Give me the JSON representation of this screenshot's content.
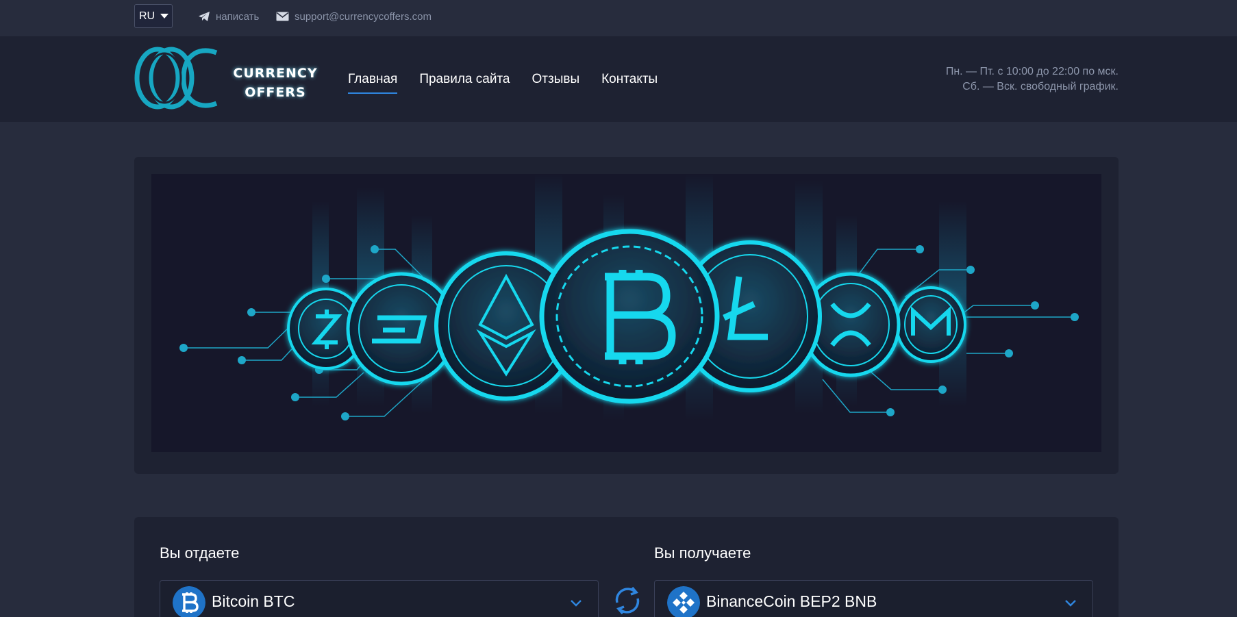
{
  "topbar": {
    "language": "RU",
    "write_label": "написать",
    "email": "support@currencycoffers.com"
  },
  "header": {
    "logo_line1": "CURRENCY",
    "logo_line2": "OFFERS",
    "nav": [
      {
        "label": "Главная",
        "active": true
      },
      {
        "label": "Правила сайта",
        "active": false
      },
      {
        "label": "Отзывы",
        "active": false
      },
      {
        "label": "Контакты",
        "active": false
      }
    ],
    "hours_line1": "Пн. — Пт. с 10:00 до 22:00 по мск.",
    "hours_line2": "Сб. — Вск. свободный график."
  },
  "banner": {
    "coins": [
      "zcash-coin",
      "dash-coin",
      "ethereum-coin",
      "bitcoin-coin",
      "litecoin-coin",
      "ripple-coin",
      "monero-coin"
    ]
  },
  "exchange": {
    "give_label": "Вы отдаете",
    "get_label": "Вы получаете",
    "give_currency": "Bitcoin BTC",
    "get_currency": "BinanceCoin BEP2 BNB"
  },
  "colors": {
    "background": "#272c3d",
    "panel": "#1e2232",
    "accent": "#2f86e0",
    "neon": "#18d8ee",
    "btc_icon": "#1f73c8"
  }
}
